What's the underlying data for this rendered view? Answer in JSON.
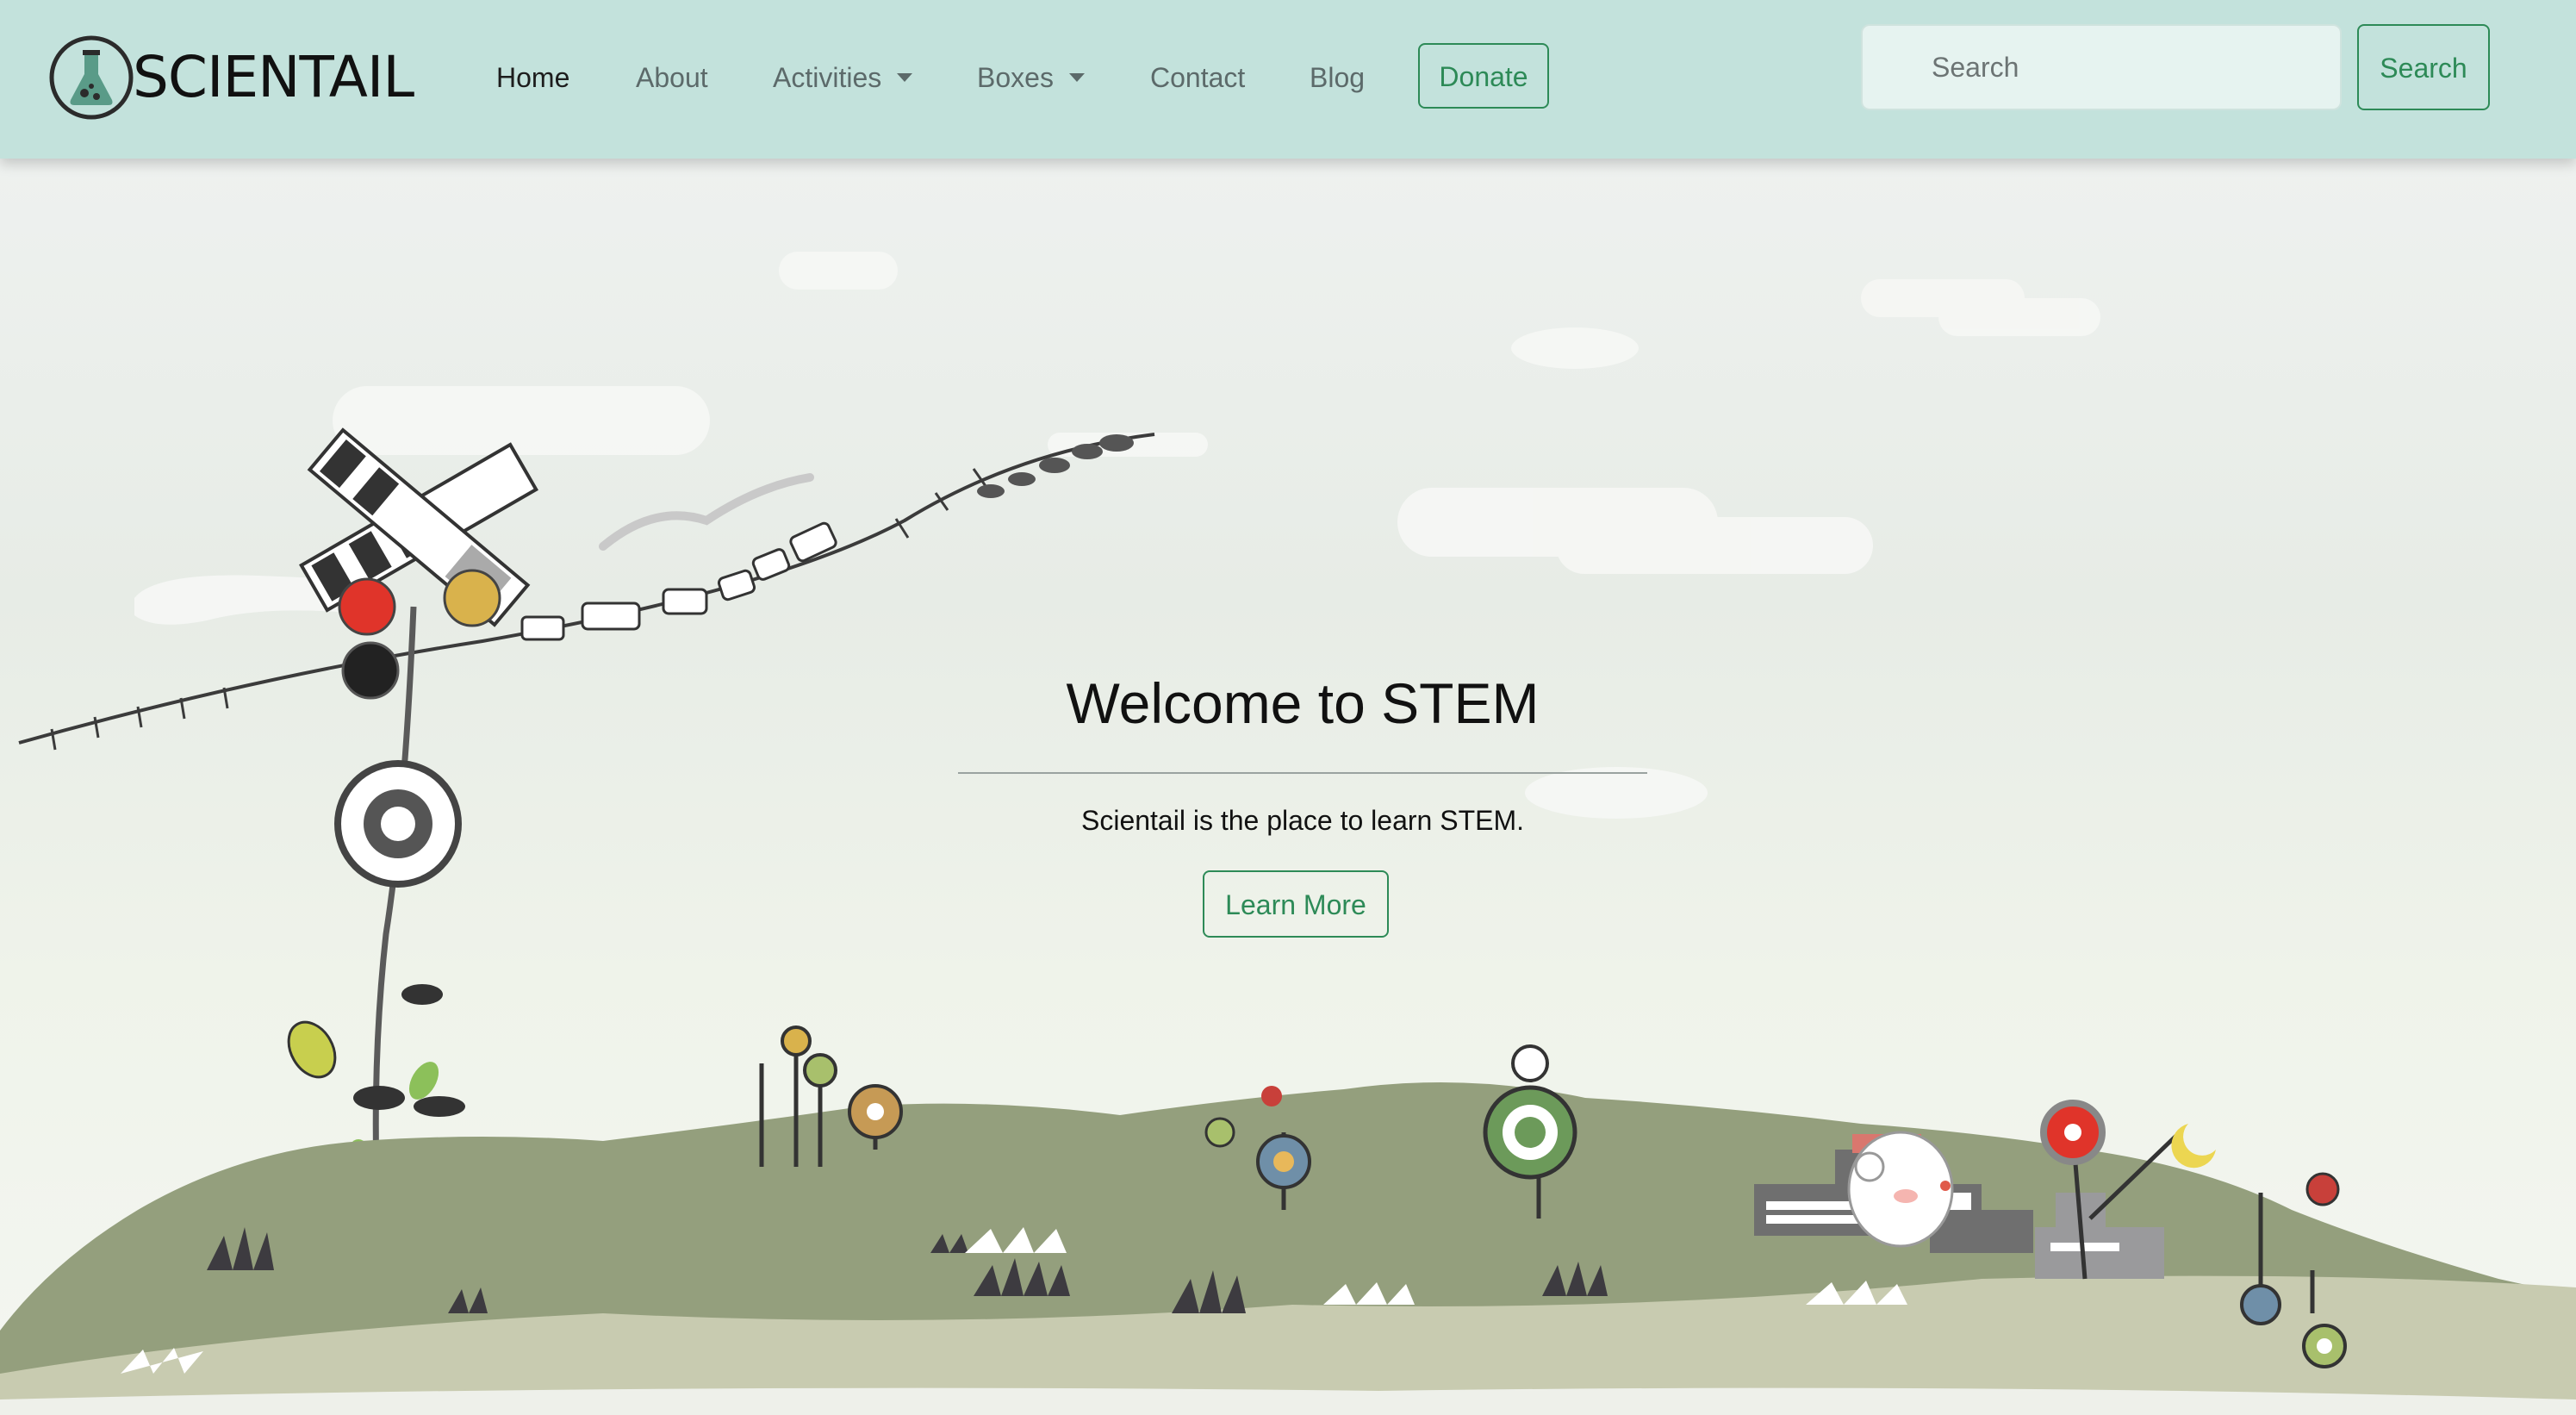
{
  "navbar": {
    "brand": "SCIENTAIL",
    "links": [
      {
        "label": "Home",
        "active": true
      },
      {
        "label": "About"
      },
      {
        "label": "Activities",
        "dropdown": true
      },
      {
        "label": "Boxes",
        "dropdown": true
      },
      {
        "label": "Contact"
      },
      {
        "label": "Blog"
      }
    ],
    "donate_label": "Donate",
    "search": {
      "placeholder": "Search",
      "value": "",
      "button_label": "Search"
    },
    "colors": {
      "background": "#c3e2dc",
      "accent": "#2d8a57"
    }
  },
  "hero": {
    "title": "Welcome to STEM",
    "subtitle": "Scientail is the place to learn STEM.",
    "button_label": "Learn More",
    "illustration": "whimsical-landscape-illustration"
  }
}
